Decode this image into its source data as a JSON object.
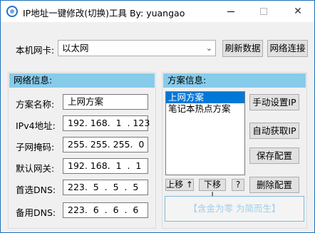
{
  "window": {
    "title": "IP地址一键修改(切换)工具  By:  yuangao",
    "minimize_glyph": "",
    "maximize_glyph": "",
    "close_glyph": "✕"
  },
  "nic": {
    "label": "本机网卡:",
    "selected": "以太网",
    "refresh_label": "刷新数据",
    "connect_label": "网络连接"
  },
  "network_info": {
    "heading": "网络信息:",
    "fields": [
      {
        "label": "方案名称:",
        "value": "上网方案"
      },
      {
        "label": "IPv4地址:",
        "value": "192. 168.  1  . 123"
      },
      {
        "label": "子网掩码:",
        "value": "255. 255. 255.  0"
      },
      {
        "label": "默认网关:",
        "value": "192. 168.  1  .  1"
      },
      {
        "label": "首选DNS:",
        "value": "223.  5  .  5  .  5"
      },
      {
        "label": "备用DNS:",
        "value": "223.  6  .  6  .  6"
      }
    ]
  },
  "plan_info": {
    "heading": "方案信息:",
    "plans": [
      "上网方案",
      "笔记本热点方案"
    ],
    "selected_index": 0,
    "buttons": {
      "manual_ip": "手动设置IP",
      "auto_ip": "自动获取IP",
      "save": "保存配置",
      "delete": "删除配置",
      "move_up": "上移 ↑",
      "move_down": "下移 ↓",
      "help": "?"
    },
    "motto": "【含金为零 为简而生】"
  },
  "colors": {
    "panel_header": "#87cbea",
    "selection": "#0078d7",
    "motto_text": "#9fcfe8"
  }
}
